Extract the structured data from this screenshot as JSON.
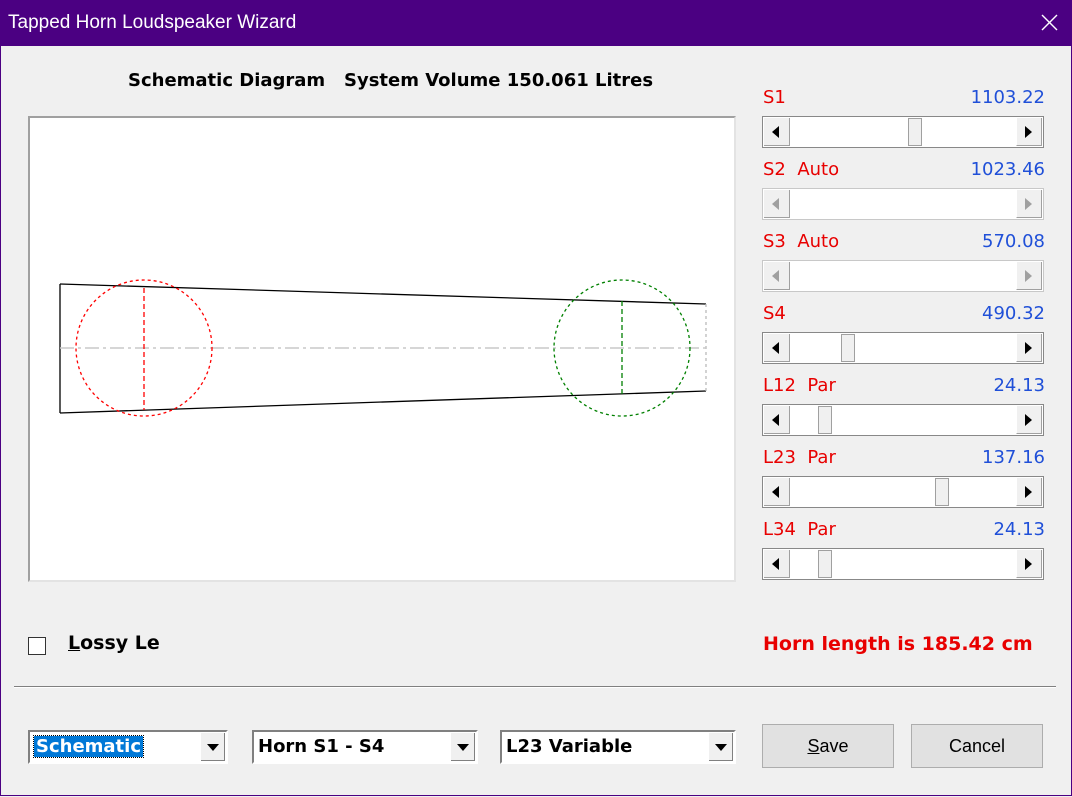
{
  "window": {
    "title": "Tapped Horn Loudspeaker Wizard"
  },
  "diagram": {
    "heading": "Schematic Diagram   System Volume 150.061 Litres"
  },
  "sliders": [
    {
      "label": "S1",
      "value": "1103.22",
      "position": 0.55,
      "enabled": true
    },
    {
      "label": "S2  Auto",
      "value": "1023.46",
      "position": 0.0,
      "enabled": false
    },
    {
      "label": "S3  Auto",
      "value": "570.08",
      "position": 0.0,
      "enabled": false
    },
    {
      "label": "S4",
      "value": "490.32",
      "position": 0.26,
      "enabled": true
    },
    {
      "label": "L12  Par",
      "value": "24.13",
      "position": 0.13,
      "enabled": true
    },
    {
      "label": "L23  Par",
      "value": "137.16",
      "position": 0.63,
      "enabled": true
    },
    {
      "label": "L34  Par",
      "value": "24.13",
      "position": 0.13,
      "enabled": true
    }
  ],
  "options": {
    "lossy_prefix": "L",
    "lossy_rest": "ossy Le",
    "lossy_checked": false
  },
  "status": {
    "horn_length": "Horn length is 185.42 cm"
  },
  "bottom": {
    "view_combo": "Schematic",
    "horn_combo": "Horn S1 - S4",
    "variable_combo": "L23 Variable",
    "save_prefix": "S",
    "save_rest": "ave",
    "cancel_label": "Cancel"
  },
  "colors": {
    "title_bar": "#4b0082",
    "label_red": "#e80000",
    "value_blue": "#2050d8",
    "driver_red": "#ff0000",
    "driver_green": "#008000"
  }
}
